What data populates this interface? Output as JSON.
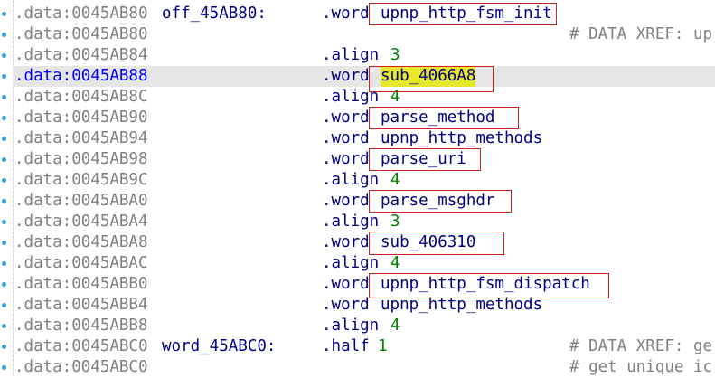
{
  "lines": [
    {
      "addr": ".data:0045AB80",
      "label": "off_45AB80:",
      "mnem": ".word",
      "op": "upnp_http_fsm_init",
      "op_type": "name",
      "comment": ""
    },
    {
      "addr": ".data:0045AB80",
      "label": "",
      "mnem": "",
      "op": "",
      "op_type": "",
      "comment": "# DATA XREF: up"
    },
    {
      "addr": ".data:0045AB84",
      "label": "",
      "mnem": ".align",
      "op": "3",
      "op_type": "num",
      "comment": ""
    },
    {
      "addr": ".data:0045AB88",
      "label": "",
      "mnem": ".word",
      "op": "sub_4066A8",
      "op_type": "name",
      "comment": ""
    },
    {
      "addr": ".data:0045AB8C",
      "label": "",
      "mnem": ".align",
      "op": "4",
      "op_type": "num",
      "comment": ""
    },
    {
      "addr": ".data:0045AB90",
      "label": "",
      "mnem": ".word",
      "op": "parse_method",
      "op_type": "name",
      "comment": ""
    },
    {
      "addr": ".data:0045AB94",
      "label": "",
      "mnem": ".word",
      "op": "upnp_http_methods",
      "op_type": "name",
      "comment": ""
    },
    {
      "addr": ".data:0045AB98",
      "label": "",
      "mnem": ".word",
      "op": "parse_uri",
      "op_type": "name",
      "comment": ""
    },
    {
      "addr": ".data:0045AB9C",
      "label": "",
      "mnem": ".align",
      "op": "4",
      "op_type": "num",
      "comment": ""
    },
    {
      "addr": ".data:0045ABA0",
      "label": "",
      "mnem": ".word",
      "op": "parse_msghdr",
      "op_type": "name",
      "comment": ""
    },
    {
      "addr": ".data:0045ABA4",
      "label": "",
      "mnem": ".align",
      "op": "3",
      "op_type": "num",
      "comment": ""
    },
    {
      "addr": ".data:0045ABA8",
      "label": "",
      "mnem": ".word",
      "op": "sub_406310",
      "op_type": "name",
      "comment": ""
    },
    {
      "addr": ".data:0045ABAC",
      "label": "",
      "mnem": ".align",
      "op": "4",
      "op_type": "num",
      "comment": ""
    },
    {
      "addr": ".data:0045ABB0",
      "label": "",
      "mnem": ".word",
      "op": "upnp_http_fsm_dispatch",
      "op_type": "name",
      "comment": ""
    },
    {
      "addr": ".data:0045ABB4",
      "label": "",
      "mnem": ".word",
      "op": "upnp_http_methods",
      "op_type": "name",
      "comment": ""
    },
    {
      "addr": ".data:0045ABB8",
      "label": "",
      "mnem": ".align",
      "op": "4",
      "op_type": "num",
      "comment": ""
    },
    {
      "addr": ".data:0045ABC0",
      "label": "word_45ABC0:",
      "mnem": ".half",
      "op": "1",
      "op_type": "num",
      "comment": "# DATA XREF: ge"
    },
    {
      "addr": ".data:0045ABC0",
      "label": "",
      "mnem": "",
      "op": "",
      "op_type": "",
      "comment": "# get unique ic"
    }
  ],
  "selected_line": ".data:0045AB88",
  "highlighted_name": "sub_4066A8",
  "colors": {
    "address": "#808080",
    "selected_address": "#0000ff",
    "code": "#000080",
    "number": "#008000",
    "comment": "#808080",
    "selected_row_bg": "#e6e6e6",
    "name_highlight": "#e7e72e",
    "annotation_box": "#d02020",
    "gutter_marker": "#3aa0dc"
  }
}
